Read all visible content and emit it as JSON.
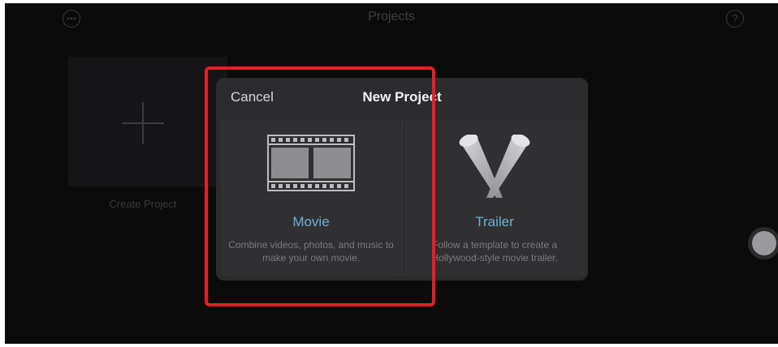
{
  "topbar": {
    "title": "Projects",
    "more_icon": "ellipsis-circle-icon",
    "help_icon": "question-circle-icon",
    "help_glyph": "?"
  },
  "background": {
    "create_project_label": "Create Project",
    "create_icon": "plus-icon"
  },
  "modal": {
    "cancel_label": "Cancel",
    "title": "New Project",
    "options": [
      {
        "title": "Movie",
        "description": "Combine videos, photos, and music to make your own movie.",
        "icon": "film-strip-icon"
      },
      {
        "title": "Trailer",
        "description": "Follow a template to create a Hollywood-style movie trailer.",
        "icon": "spotlights-icon"
      }
    ]
  },
  "colors": {
    "highlight": "#e81e25",
    "accent": "#6fb0d8",
    "modal_bg": "#2c2c2e",
    "screen_bg": "#0b0b0c"
  }
}
